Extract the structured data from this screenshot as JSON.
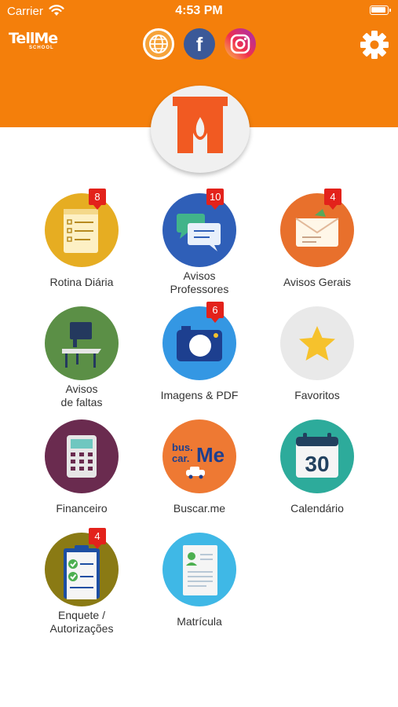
{
  "status_bar": {
    "carrier": "Carrier",
    "time": "4:53 PM"
  },
  "header": {
    "background_color": "#f47f0b",
    "logo_text": "TellMe",
    "logo_subtext": "SCHOOL",
    "social_icons": [
      "globe-icon",
      "facebook-icon",
      "instagram-icon"
    ],
    "facebook_glyph": "f",
    "settings_icon": "gear-icon"
  },
  "tiles": [
    {
      "label": "Rotina Diária",
      "badge": "8",
      "color": "#e6ad22",
      "icon": "routine-checklist-icon"
    },
    {
      "label": "Avisos\nProfessores",
      "badge": "10",
      "color": "#2f5fb8",
      "icon": "chat-bubbles-icon"
    },
    {
      "label": "Avisos Gerais",
      "badge": "4",
      "color": "#e8702c",
      "icon": "envelope-icon"
    },
    {
      "label": "Avisos\nde faltas",
      "badge": "",
      "color": "#5b8f46",
      "icon": "school-desk-icon"
    },
    {
      "label": "Imagens & PDF",
      "badge": "6",
      "color": "#3497e3",
      "icon": "camera-icon"
    },
    {
      "label": "Favoritos",
      "badge": "",
      "color": "#e9e9e9",
      "icon": "star-icon"
    },
    {
      "label": "Financeiro",
      "badge": "",
      "color": "#6a2b4f",
      "icon": "calculator-icon"
    },
    {
      "label": "Buscar.me",
      "badge": "",
      "color": "#ee7933",
      "icon": "bus-car-me-icon",
      "icon_text_top": "bus.",
      "icon_text_bottom": "car.",
      "icon_text_me": "Me"
    },
    {
      "label": "Calendário",
      "badge": "",
      "color": "#2dab9b",
      "icon": "calendar-icon",
      "icon_text": "30"
    },
    {
      "label": "Enquete /\nAutorizações",
      "badge": "4",
      "color": "#8a7a14",
      "icon": "clipboard-check-icon"
    },
    {
      "label": "Matrícula",
      "badge": "",
      "color": "#3fb8e6",
      "icon": "document-profile-icon"
    }
  ]
}
